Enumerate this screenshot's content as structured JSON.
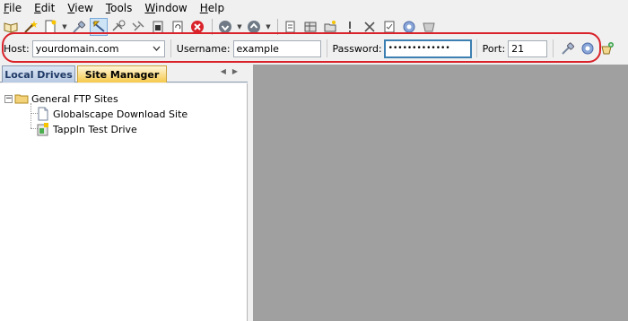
{
  "menu": [
    {
      "label": "File",
      "ul": "F",
      "rest": "ile"
    },
    {
      "label": "Edit",
      "ul": "E",
      "rest": "dit"
    },
    {
      "label": "View",
      "ul": "V",
      "rest": "iew"
    },
    {
      "label": "Tools",
      "ul": "T",
      "rest": "ools",
      "pre": ""
    },
    {
      "label": "Window",
      "ul": "W",
      "rest": "indow"
    },
    {
      "label": "Help",
      "ul": "H",
      "rest": "elp"
    }
  ],
  "connection": {
    "host_label": "Host:",
    "host_value": "yourdomain.com",
    "username_label": "Username:",
    "username_value": "example",
    "password_label": "Password:",
    "password_value": "•••••••••••••",
    "port_label": "Port:",
    "port_value": "21"
  },
  "tabs": {
    "local": "Local Drives",
    "site": "Site Manager"
  },
  "tree": {
    "root": "General FTP Sites",
    "expander": "−",
    "children": [
      "Globalscape Download Site",
      "TappIn Test Drive"
    ]
  }
}
